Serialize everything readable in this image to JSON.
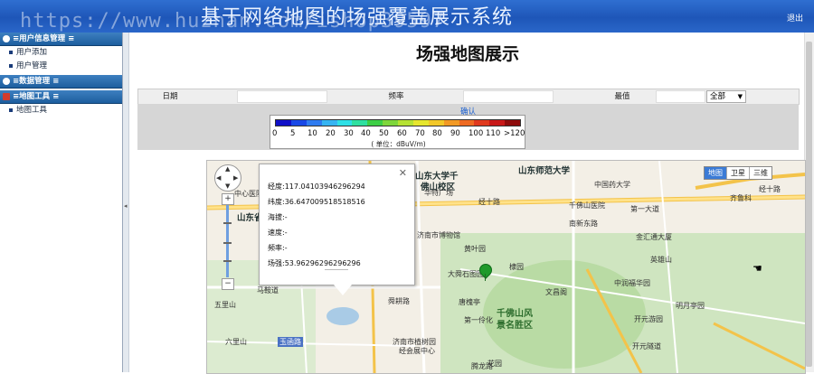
{
  "header": {
    "title": "基于网络地图的场强覆盖展示系统",
    "watermark": "https://www.huzhan.com/ishop39597",
    "logout": "退出"
  },
  "sidebar": {
    "sections": [
      {
        "title": "用户信息管理",
        "items": [
          "用户添加",
          "用户管理"
        ]
      },
      {
        "title": "数据管理",
        "items": []
      },
      {
        "title": "地图工具",
        "items": [
          "地图工具"
        ]
      }
    ]
  },
  "page": {
    "title": "场强地图展示"
  },
  "filter": {
    "date_label": "日期",
    "date_value": "",
    "freq_label": "频率",
    "freq_value": "",
    "max_label": "最值",
    "max_value": "",
    "select_value": "全部",
    "confirm_label": "确认"
  },
  "legend": {
    "ticks": [
      "0",
      "5",
      "10",
      "20",
      "30",
      "40",
      "50",
      "60",
      "70",
      "80",
      "90",
      "100",
      "110",
      ">120"
    ],
    "unit": "( 单位：dBuV/m)",
    "colors": [
      "#1010c8",
      "#1848e6",
      "#2f7cf0",
      "#36b4f2",
      "#2ee0e6",
      "#2fe0a0",
      "#3ecf46",
      "#7ed63c",
      "#b6e234",
      "#e6e62e",
      "#f2c82a",
      "#f29a26",
      "#ee6a22",
      "#e03a1e",
      "#c81818",
      "#8e0c0c"
    ]
  },
  "map": {
    "type_buttons": [
      "地图",
      "卫星",
      "三维"
    ],
    "active_type": "地图",
    "labels": [
      "山东大学千",
      "佛山校区",
      "山东师范大学",
      "中国药大学",
      "经十路",
      "千佛山医院",
      "第一大道",
      "金汇通大厦",
      "英雄山",
      "齐鲁科",
      "山东省",
      "中心医院",
      "济南市博物馆",
      "黄叶园",
      "大舜石图园",
      "棣园",
      "文昌阁",
      "唐槐亭",
      "第一伶化",
      "千佛山风",
      "景名胜区",
      "中润福华园",
      "明月亭园",
      "开元游园",
      "开元隧道",
      "五里山",
      "六里山",
      "马鞍道",
      "玉函路",
      "济南市植树园",
      "经会展中心",
      "舜耕路",
      "腾龙路",
      "华特广场",
      "南新东路",
      "经十路",
      "花园"
    ]
  },
  "popup": {
    "lng_label": "经度:",
    "lng_value": "117.04103946296294",
    "lat_label": "纬度:",
    "lat_value": "36.647009518518516",
    "alt_label": "海拔:",
    "alt_value": "-",
    "speed_label": "速度:",
    "speed_value": "-",
    "freq_label": "频率:",
    "freq_value": "-",
    "field_label": "场强:",
    "field_value": "53.96296296296296"
  }
}
